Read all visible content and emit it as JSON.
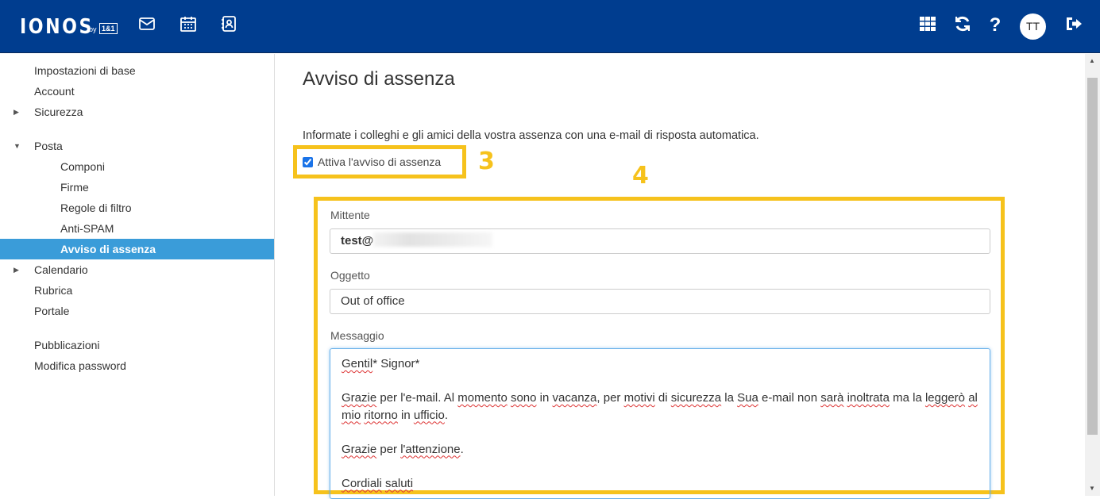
{
  "header": {
    "logo": "IONOS",
    "logo_by": "by",
    "logo_brand": "1&1",
    "icons": [
      "mail-icon",
      "calendar-icon",
      "contacts-icon",
      "apps-grid-icon",
      "refresh-icon",
      "help-icon",
      "logout-icon"
    ],
    "avatar_initials": "TT"
  },
  "sidebar": {
    "items": [
      {
        "label": "Impostazioni di base"
      },
      {
        "label": "Account"
      },
      {
        "label": "Sicurezza"
      },
      {
        "label": "Posta"
      },
      {
        "label": "Componi"
      },
      {
        "label": "Firme"
      },
      {
        "label": "Regole di filtro"
      },
      {
        "label": "Anti-SPAM"
      },
      {
        "label": "Avviso di assenza"
      },
      {
        "label": "Calendario"
      },
      {
        "label": "Rubrica"
      },
      {
        "label": "Portale"
      },
      {
        "label": "Pubblicazioni"
      },
      {
        "label": "Modifica password"
      }
    ]
  },
  "main": {
    "title": "Avviso di assenza",
    "intro": "Informate i colleghi e gli amici della vostra assenza con una e-mail di risposta automatica.",
    "checkbox_label": "Attiva l'avviso di assenza",
    "checkbox_checked": true,
    "annotation_3": "3",
    "annotation_4": "4",
    "sender_label": "Mittente",
    "sender_value": "test@",
    "subject_label": "Oggetto",
    "subject_value": "Out of office",
    "message_label": "Messaggio",
    "message": {
      "l1a": "Gentil",
      "l1b": "* Signor*",
      "p2": [
        "Grazie",
        " per l'e-mail. Al ",
        "momento",
        " ",
        "sono",
        " in ",
        "vacanza",
        ", per ",
        "motivi",
        " di ",
        "sicurezza",
        " la ",
        "Sua",
        " e-mail non ",
        "sarà",
        " ",
        "inoltrata",
        " ma la ",
        "leggerò",
        " ",
        "al",
        " ",
        "mio",
        " ",
        "ritorno",
        " in ",
        "ufficio",
        "."
      ],
      "p3": [
        "Grazie",
        " per ",
        "l'attenzione",
        "."
      ],
      "p4": [
        "Cordiali",
        " ",
        "saluti"
      ]
    }
  },
  "colors": {
    "header_bg": "#003d8f",
    "active_item": "#3a9cd9",
    "highlight": "#f6c21c"
  }
}
